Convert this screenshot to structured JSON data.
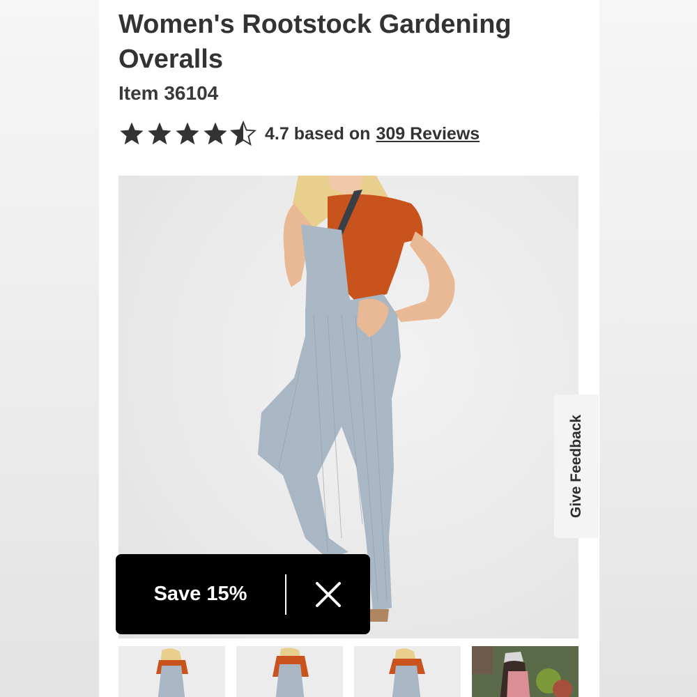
{
  "product": {
    "title": "Women's Rootstock Gardening Overalls",
    "item_number": "Item 36104"
  },
  "rating": {
    "value": 4.7,
    "stars_out_of": 5,
    "summary": "4.7 based on",
    "reviews_link": "309 Reviews"
  },
  "feedback_tab": {
    "label": "Give Feedback"
  },
  "promo": {
    "label": "Save 15%",
    "close_icon": "close-icon"
  },
  "gallery": {
    "thumbnail_count": 4
  },
  "colors": {
    "shirt": "#c9531c",
    "denim": "#a9b7c4",
    "promo_bg": "#000000",
    "text": "#333333"
  }
}
